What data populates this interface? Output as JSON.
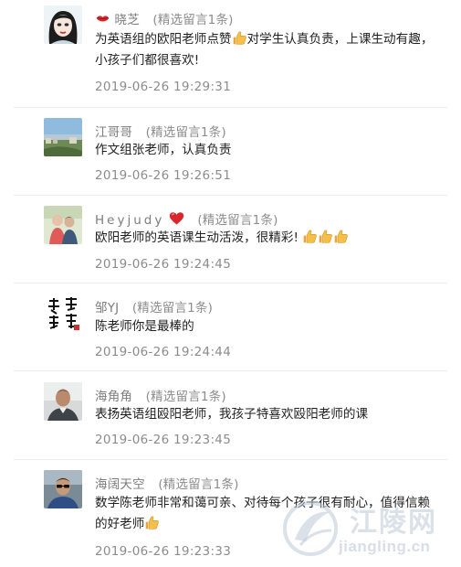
{
  "comments": [
    {
      "nickname": "晓芝",
      "tag": "(精选留言1条)",
      "text": "为英语组的欧阳老师点赞👍对学生认真负责，上课生动有趣，小孩子们都很喜欢!",
      "time": "2019-06-26 19:29:31",
      "avatar_icon": "cartoon-woman-avatar",
      "name_prefix_icon": "lips-emoji"
    },
    {
      "nickname": "江哥哥",
      "tag": "(精选留言1条)",
      "text": "作文组张老师，认真负责",
      "time": "2019-06-26 19:26:51",
      "avatar_icon": "landscape-photo-avatar"
    },
    {
      "nickname": "Heyjudy",
      "tag": "(精选留言1条)",
      "text": "欧阳老师的英语课生动活泼，很精彩!",
      "time": "2019-06-26 19:24:45",
      "avatar_icon": "couple-photo-avatar",
      "name_suffix_icon": "heart-emoji",
      "trailing_emoji": [
        "thumbs-up-emoji",
        "thumbs-up-emoji",
        "thumbs-up-emoji"
      ]
    },
    {
      "nickname": "邹YJ",
      "tag": "(精选留言1条)",
      "text": "陈老师你是最棒的",
      "time": "2019-06-26 19:24:44",
      "avatar_icon": "calligraphy-avatar"
    },
    {
      "nickname": "海角角",
      "tag": "(精选留言1条)",
      "text": "表扬英语组殴阳老师，我孩子特喜欢殴阳老师的课",
      "time": "2019-06-26 19:23:45",
      "avatar_icon": "man-portrait-avatar"
    },
    {
      "nickname": "海阔天空",
      "tag": "(精选留言1条)",
      "text": "数学陈老师非常和蔼可亲、对待每个孩子很有耐心，值得信赖的好老师",
      "time": "2019-06-26 19:23:33",
      "avatar_icon": "man-sunglasses-avatar",
      "trailing_emoji": [
        "thumbs-up-emoji"
      ]
    }
  ],
  "watermark": {
    "title": "江陵网",
    "url": "jiangling.cn",
    "icon": "jiangling-logo-icon"
  },
  "colors": {
    "meta_gray": "#8c8c8c",
    "text": "#222222",
    "divider": "#ececec",
    "thumb_yellow": "#f2b441",
    "heart_red": "#d8262d"
  }
}
